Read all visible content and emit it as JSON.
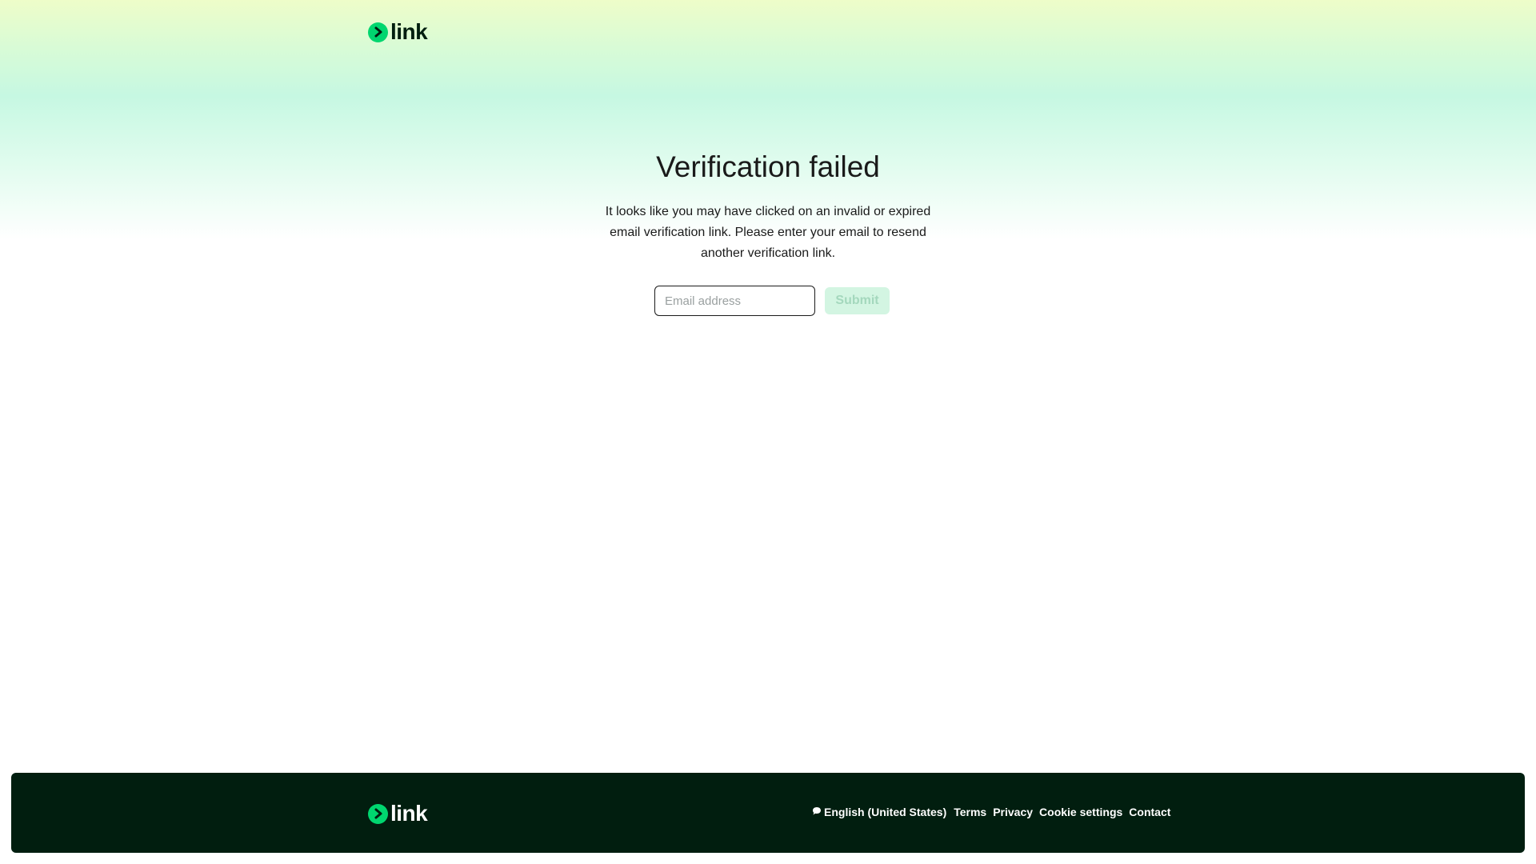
{
  "header": {
    "logo_text": "link",
    "brand_color": "#00d66f"
  },
  "main": {
    "title": "Verification failed",
    "description": "It looks like you may have clicked on an invalid or expired email verification link. Please enter your email to resend another verification link.",
    "email_placeholder": "Email address",
    "email_value": "",
    "submit_label": "Submit"
  },
  "footer": {
    "logo_text": "link",
    "language": "English (United States)",
    "links": [
      "Terms",
      "Privacy",
      "Cookie settings",
      "Contact"
    ],
    "background": "#011e0f"
  }
}
